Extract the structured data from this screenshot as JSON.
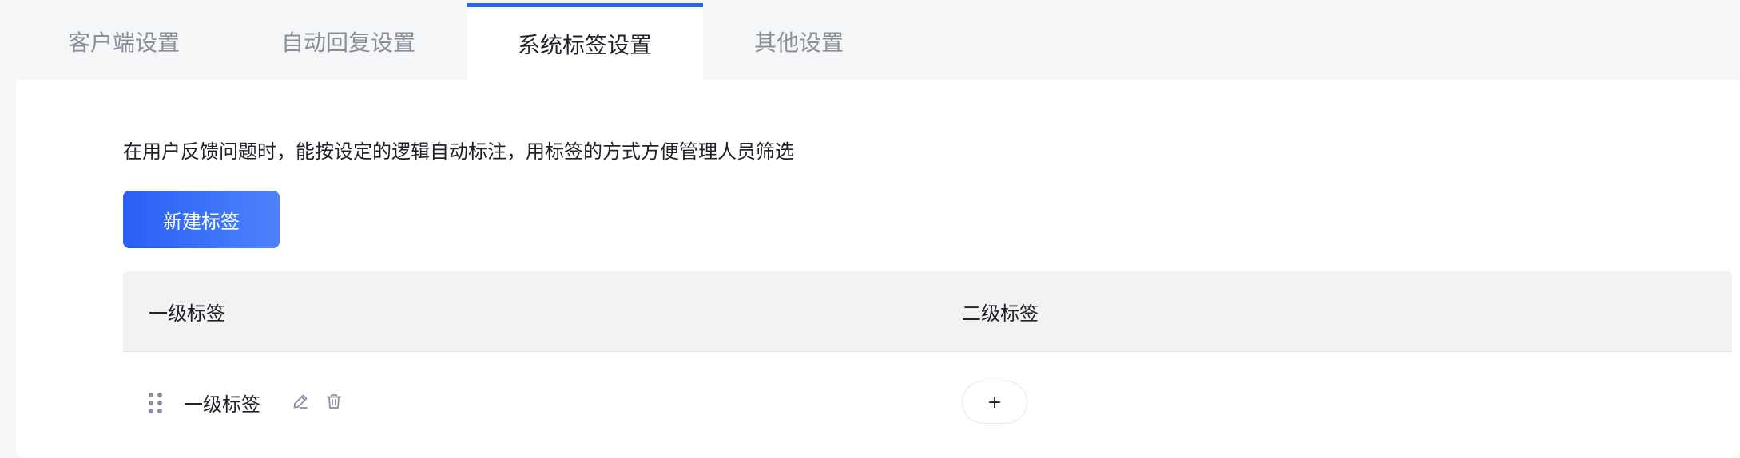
{
  "tabs": [
    {
      "label": "客户端设置",
      "active": false
    },
    {
      "label": "自动回复设置",
      "active": false
    },
    {
      "label": "系统标签设置",
      "active": true
    },
    {
      "label": "其他设置",
      "active": false
    }
  ],
  "colors": {
    "accent": "#2b63f0",
    "button_gradient_start": "#2a5ff6",
    "button_gradient_end": "#4c82fb",
    "background": "#f5f6f8",
    "table_header_bg": "#f2f2f2"
  },
  "panel": {
    "description": "在用户反馈问题时，能按设定的逻辑自动标注，用标签的方式方便管理人员筛选",
    "new_button_label": "新建标签"
  },
  "table": {
    "columns": [
      "一级标签",
      "二级标签"
    ],
    "rows": [
      {
        "primary_tag": "一级标签",
        "icons": [
          "drag-handle-icon",
          "edit-icon",
          "delete-icon"
        ],
        "secondary_action_label": "+"
      }
    ]
  }
}
